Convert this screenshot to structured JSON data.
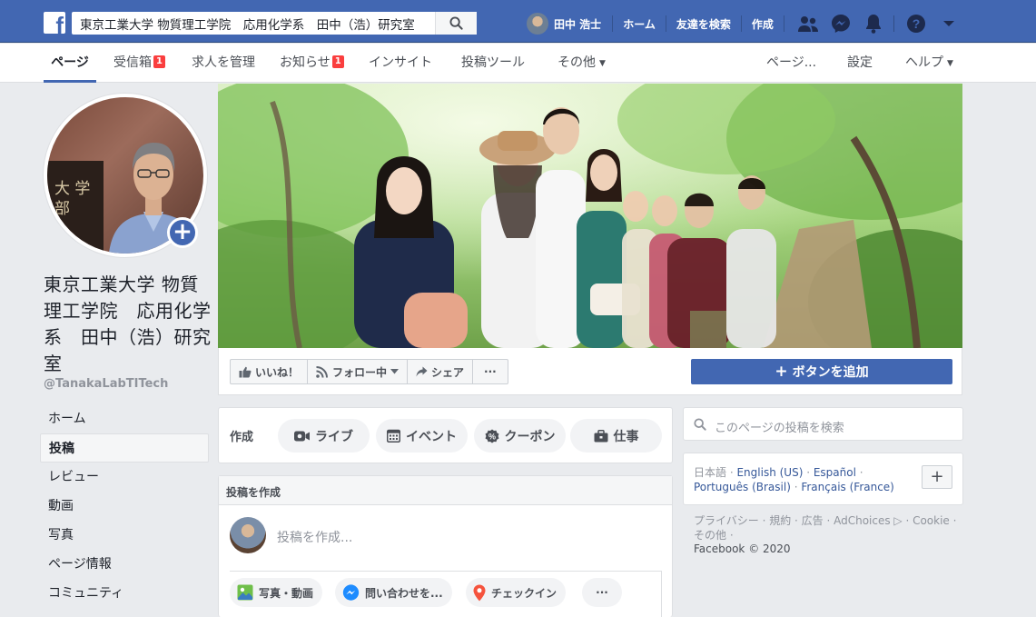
{
  "topbar": {
    "search_query": "東京工業大学 物質理工学院　応用化学系　田中（浩）研究室",
    "user_name": "田中 浩士",
    "nav": [
      "ホーム",
      "友達を検索",
      "作成"
    ]
  },
  "subnav": {
    "tabs": [
      {
        "label": "ページ"
      },
      {
        "label": "受信箱",
        "badge": "1"
      },
      {
        "label": "求人を管理"
      },
      {
        "label": "お知らせ",
        "badge": "1"
      },
      {
        "label": "インサイト"
      },
      {
        "label": "投稿ツール"
      },
      {
        "label": "その他"
      }
    ],
    "right": [
      "ページ...",
      "設定",
      "ヘルプ"
    ]
  },
  "profile": {
    "sign_text": "大 学\n部",
    "page_name": "東京工業大学 物質理工学院　応用化学系　田中（浩）研究室",
    "handle": "@TanakaLabTITech"
  },
  "leftnav": [
    "ホーム",
    "投稿",
    "レビュー",
    "動画",
    "写真",
    "ページ情報",
    "コミュニティ"
  ],
  "actions": {
    "like": "いいね！",
    "follow": "フォロー中",
    "share": "シェア",
    "more": "···",
    "add_button": "ボタンを追加"
  },
  "create": {
    "label": "作成",
    "live": "ライブ",
    "event": "イベント",
    "coupon": "クーポン",
    "job": "仕事"
  },
  "post": {
    "header": "投稿を作成",
    "placeholder": "投稿を作成...",
    "photo": "写真・動画",
    "inquiry": "問い合わせを...",
    "checkin": "チェックイン",
    "more": "···"
  },
  "right": {
    "search_placeholder": "このページの投稿を検索",
    "lang_current": "日本語",
    "lang_links": [
      "English (US)",
      "Español",
      "Português (Brasil)",
      "Français (France)"
    ],
    "footer_links": "プライバシー · 規約 · 広告 · AdChoices ▷ · Cookie · その他 ·",
    "copyright": "Facebook © 2020"
  },
  "colors": {
    "brand": "#4267b2",
    "badge": "#fa3e3e"
  }
}
